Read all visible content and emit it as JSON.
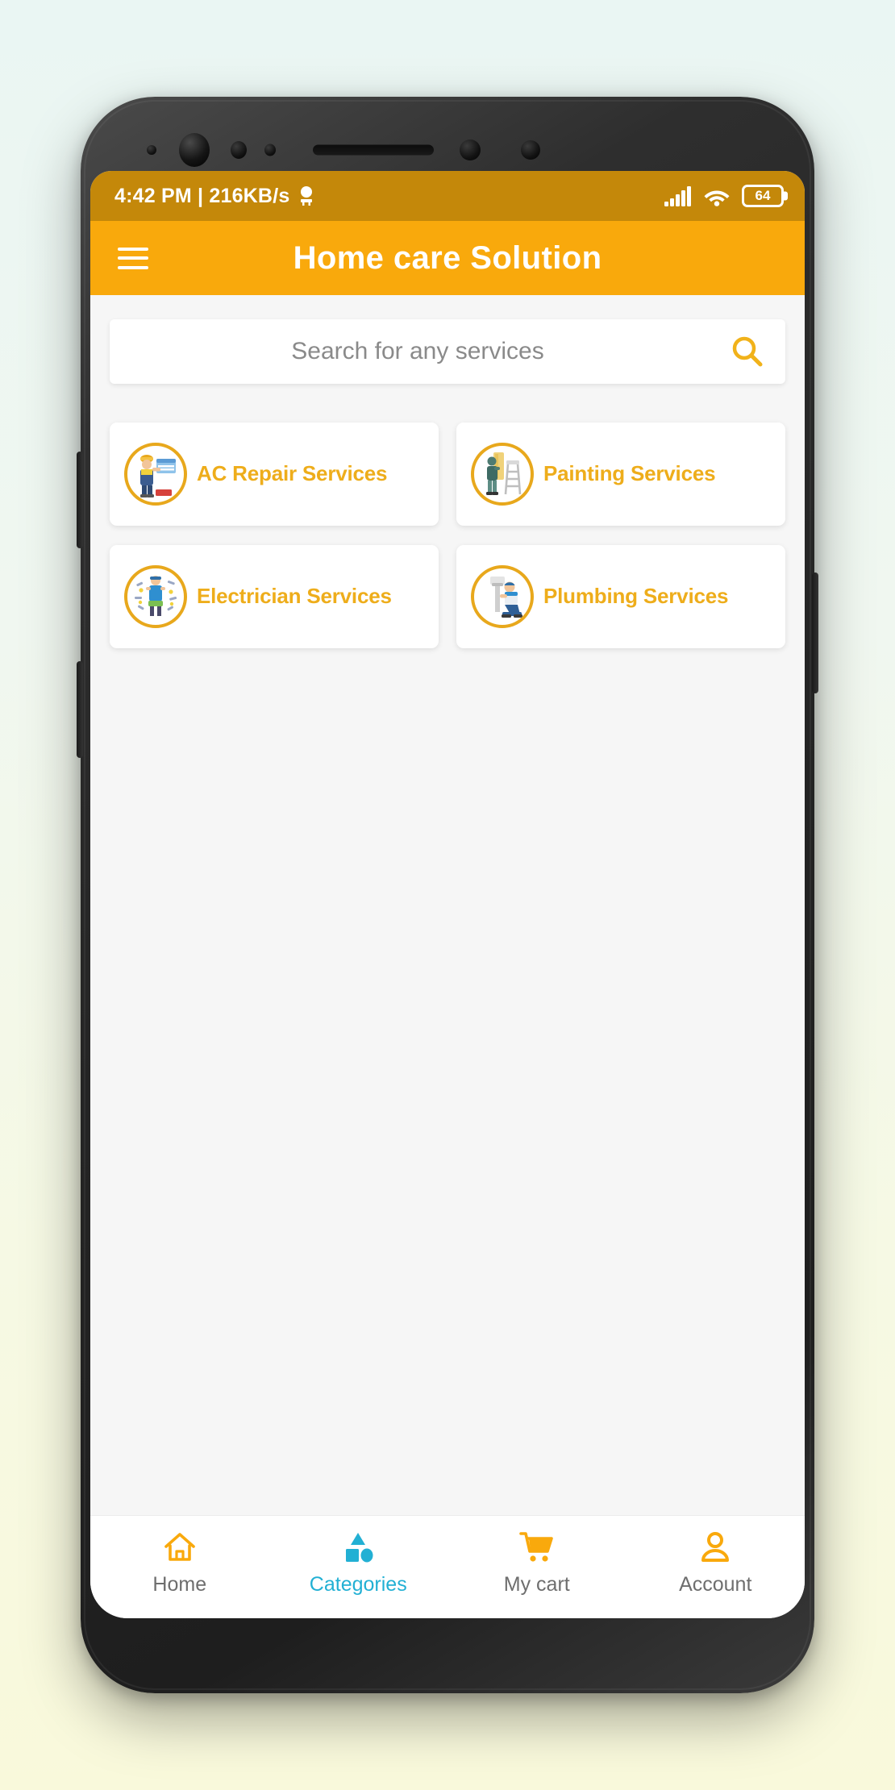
{
  "device": {
    "frame_color": "#2b2b2b",
    "page_background_top": "#eaf6f3",
    "page_background_bottom": "#f9f9db"
  },
  "status_bar": {
    "time_and_speed": "4:42 PM | 216KB/s",
    "hotspot_icon": "hotspot-icon",
    "signal_icon": "signal-bars-icon",
    "wifi_icon": "wifi-icon",
    "battery_level": "64",
    "background_color": "#c4880a",
    "text_color": "#ffffff"
  },
  "app_bar": {
    "menu_icon": "hamburger-menu-icon",
    "title": "Home care Solution",
    "background_color": "#f9a90c",
    "text_color": "#ffffff"
  },
  "search": {
    "placeholder": "Search for any services",
    "value": "",
    "icon": "search-icon",
    "icon_color": "#f1b21a"
  },
  "categories": {
    "accent_color": "#eead1b",
    "items": [
      {
        "label": "AC Repair Services",
        "icon": "ac-repair-icon"
      },
      {
        "label": "Painting Services",
        "icon": "painting-icon"
      },
      {
        "label": "Electrician Services",
        "icon": "electrician-icon"
      },
      {
        "label": "Plumbing Services",
        "icon": "plumbing-icon"
      }
    ]
  },
  "bottom_nav": {
    "active_color": "#22b0d4",
    "inactive_color": "#6e6e6e",
    "icon_color": "#f9a90c",
    "items": [
      {
        "label": "Home",
        "icon": "home-icon",
        "active": false
      },
      {
        "label": "Categories",
        "icon": "categories-shapes-icon",
        "active": true
      },
      {
        "label": "My cart",
        "icon": "shopping-cart-icon",
        "active": false
      },
      {
        "label": "Account",
        "icon": "account-person-icon",
        "active": false
      }
    ]
  }
}
